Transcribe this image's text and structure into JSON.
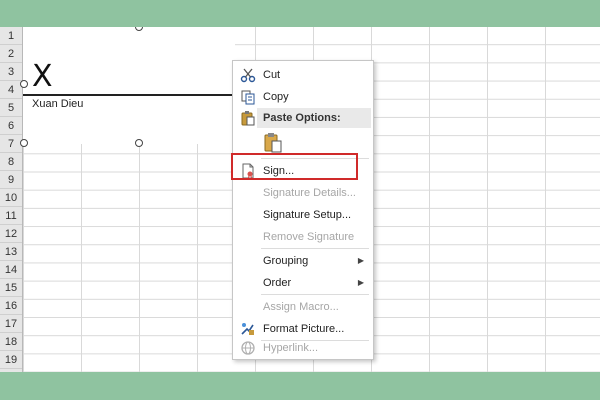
{
  "row_headers": [
    "1",
    "2",
    "3",
    "4",
    "5",
    "6",
    "7",
    "8",
    "9",
    "10",
    "11",
    "12",
    "13",
    "14",
    "15",
    "16",
    "17",
    "18",
    "19"
  ],
  "signature_line": {
    "mark": "X",
    "signer_name": "Xuan Dieu"
  },
  "context_menu": {
    "items": [
      {
        "id": "cut",
        "label": "Cut",
        "icon": "scissors-icon",
        "enabled": true
      },
      {
        "id": "copy",
        "label": "Copy",
        "icon": "copy-icon",
        "enabled": true
      },
      {
        "id": "paste_options",
        "label": "Paste Options:",
        "icon": "paste-icon",
        "enabled": true
      },
      {
        "id": "sign",
        "label": "Sign...",
        "icon": "sign-document-icon",
        "enabled": true
      },
      {
        "id": "signature_details",
        "label": "Signature Details...",
        "enabled": false
      },
      {
        "id": "signature_setup",
        "label": "Signature Setup...",
        "enabled": true
      },
      {
        "id": "remove_signature",
        "label": "Remove Signature",
        "enabled": false
      },
      {
        "id": "grouping",
        "label": "Grouping",
        "enabled": true,
        "submenu": true
      },
      {
        "id": "order",
        "label": "Order",
        "enabled": true,
        "submenu": true
      },
      {
        "id": "assign_macro",
        "label": "Assign Macro...",
        "enabled": false
      },
      {
        "id": "format_picture",
        "label": "Format Picture...",
        "icon": "format-picture-icon",
        "enabled": true
      },
      {
        "id": "hyperlink",
        "label": "Hyperlink...",
        "icon": "hyperlink-icon",
        "enabled": false
      }
    ]
  },
  "colors": {
    "page_background": "#8fc3a0",
    "highlight_border": "#d02a2a",
    "disabled_text": "#a6a6a6"
  }
}
